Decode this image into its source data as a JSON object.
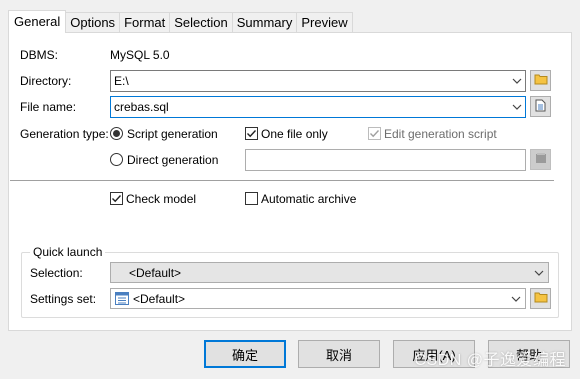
{
  "tabs": [
    "General",
    "Options",
    "Format",
    "Selection",
    "Summary",
    "Preview"
  ],
  "general": {
    "dbms_label": "DBMS:",
    "dbms_value": "MySQL 5.0",
    "directory_label": "Directory:",
    "directory_value": "E:\\",
    "filename_label": "File name:",
    "filename_value": "crebas.sql",
    "gentype_label": "Generation type:",
    "script_generation": "Script generation",
    "direct_generation": "Direct generation",
    "one_file_only": "One file only",
    "edit_generation_script": "Edit generation script",
    "direct_value": "",
    "check_model": "Check model",
    "automatic_archive": "Automatic archive"
  },
  "quick_launch": {
    "title": "Quick launch",
    "selection_label": "Selection:",
    "selection_value": "<Default>",
    "settings_label": "Settings set:",
    "settings_value": "<Default>"
  },
  "buttons": {
    "ok": "确定",
    "cancel": "取消",
    "apply": "应用(A)",
    "help": "帮助"
  },
  "watermark": "CSDN @子逸爱编程",
  "state": {
    "script_generation_selected": true,
    "one_file_only_checked": true,
    "edit_generation_script_checked": true,
    "check_model_checked": true,
    "automatic_archive_checked": false
  },
  "icons": [
    "chevron-down-icon",
    "folder-icon",
    "document-icon",
    "list-icon",
    "checkmark-icon"
  ]
}
